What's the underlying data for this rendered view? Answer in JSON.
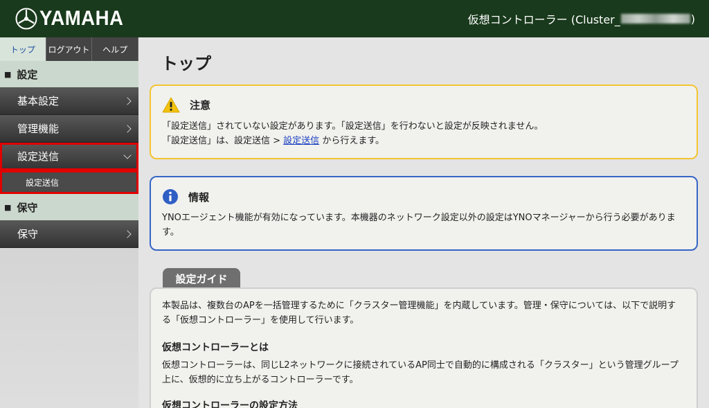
{
  "header": {
    "brand": "YAMAHA",
    "device_title_prefix": "仮想コントローラー (Cluster_",
    "device_title_suffix": ")"
  },
  "sidebar": {
    "tabs": [
      {
        "label": "トップ",
        "active": true
      },
      {
        "label": "ログアウト",
        "active": false
      },
      {
        "label": "ヘルプ",
        "active": false
      }
    ],
    "sections": [
      {
        "label": "設定",
        "items": [
          {
            "label": "基本設定",
            "expanded": false
          },
          {
            "label": "管理機能",
            "expanded": false
          },
          {
            "label": "設定送信",
            "expanded": true,
            "highlighted": true,
            "children": [
              {
                "label": "設定送信",
                "highlighted": true
              }
            ]
          }
        ]
      },
      {
        "label": "保守",
        "items": [
          {
            "label": "保守",
            "expanded": false
          }
        ]
      }
    ]
  },
  "main": {
    "title": "トップ",
    "warning": {
      "icon": "warning-icon",
      "color": "#f4c430",
      "title": "注意",
      "line1": "「設定送信」されていない設定があります。「設定送信」を行わないと設定が反映されません。",
      "line2_prefix": "「設定送信」は、設定送信 > ",
      "line2_link": "設定送信",
      "line2_suffix": " から行えます。"
    },
    "info": {
      "icon": "info-icon",
      "color": "#3565c6",
      "title": "情報",
      "text": "YNOエージェント機能が有効になっています。本機器のネットワーク設定以外の設定はYNOマネージャーから行う必要があります。"
    },
    "guide": {
      "tab_label": "設定ガイド",
      "intro": "本製品は、複数台のAPを一括管理するために「クラスター管理機能」を内蔵しています。管理・保守については、以下で説明する「仮想コントローラー」を使用して行います。",
      "heading1": "仮想コントローラーとは",
      "text1": "仮想コントローラーは、同じL2ネットワークに接続されているAP同士で自動的に構成される「クラスター」という管理グループ上に、仮想的に立ち上がるコントローラーです。",
      "heading2": "仮想コントローラーの設定方法"
    }
  }
}
